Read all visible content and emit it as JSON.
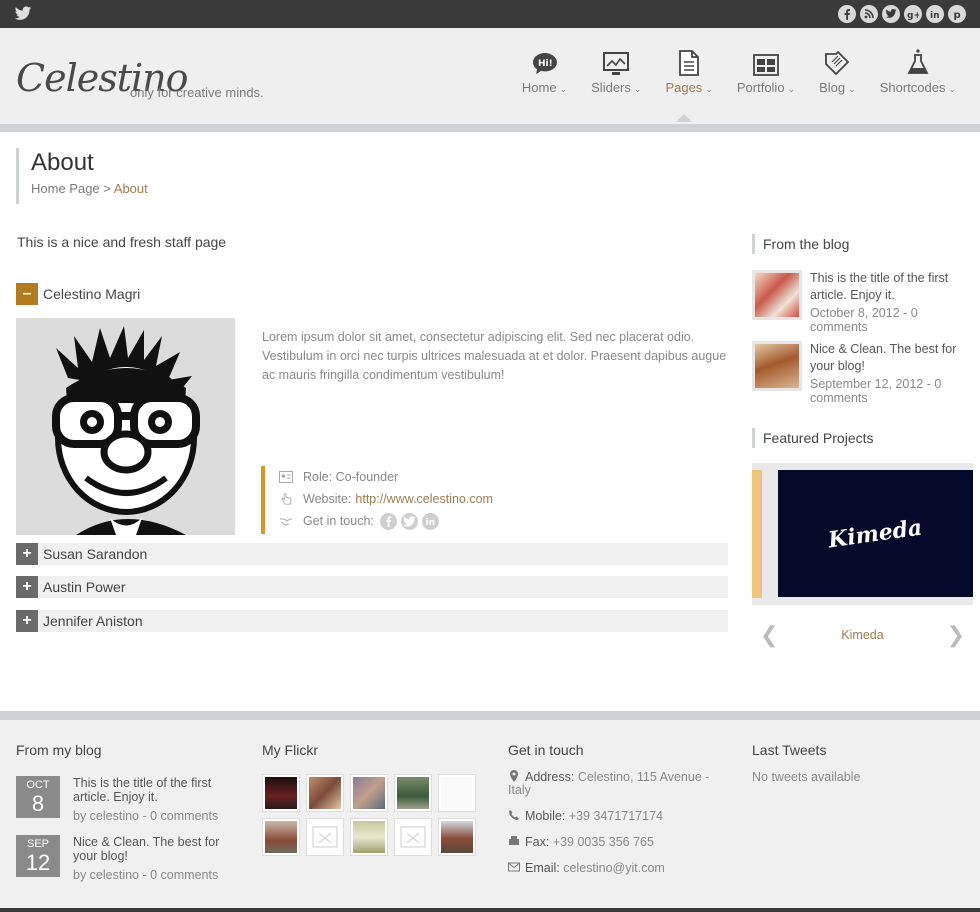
{
  "header": {
    "logo": "Celestino",
    "tagline": "only for creative minds.",
    "nav": [
      {
        "label": "Home",
        "icon": "speech-bubble-icon"
      },
      {
        "label": "Sliders",
        "icon": "chart-icon"
      },
      {
        "label": "Pages",
        "icon": "document-icon",
        "active": true
      },
      {
        "label": "Portfolio",
        "icon": "grid-icon"
      },
      {
        "label": "Blog",
        "icon": "tag-icon"
      },
      {
        "label": "Shortcodes",
        "icon": "flask-icon"
      }
    ],
    "home_icon_text": "Hi!"
  },
  "page": {
    "title": "About",
    "breadcrumb_home": "Home Page",
    "breadcrumb_sep": ">",
    "breadcrumb_current": "About",
    "intro": "This is a nice and fresh staff page"
  },
  "staff": {
    "open_name": "Celestino Magri",
    "bio": "Lorem ipsum dolor sit amet, consectetur adipiscing elit. Sed nec placerat odio. Vestibulum in orci nec turpis ultrices malesuada at et dolor. Praesent dapibus augue ac mauris fringilla condimentum vestibulum!",
    "role": "Role: Co-founder",
    "website_label": "Website:",
    "website_url": "http://www.celestino.com",
    "contact_label": "Get in touch:",
    "others": [
      "Susan Sarandon",
      "Austin Power",
      "Jennifer Aniston"
    ]
  },
  "sidebar": {
    "blog_heading": "From the blog",
    "posts": [
      {
        "title": "This is the title of the first article. Enjoy it.",
        "date": "October 8, 2012 - 0 comments"
      },
      {
        "title": "Nice & Clean. The best for your blog!",
        "date": "September 12, 2012 - 0 comments"
      }
    ],
    "featured_heading": "Featured Projects",
    "featured_image_text": "Kimeda",
    "featured_caption": "Kimeda"
  },
  "footer": {
    "blog_heading": "From my blog",
    "posts": [
      {
        "month": "OCT",
        "day": "8",
        "title": "This is the title of the first article. Enjoy it.",
        "by": "by celestino - 0 comments"
      },
      {
        "month": "SEP",
        "day": "12",
        "title": "Nice & Clean. The best for your blog!",
        "by": "by celestino - 0 comments"
      }
    ],
    "flickr_heading": "My Flickr",
    "contact_heading": "Get in touch",
    "address_label": "Address:",
    "address": "Celestino, 115 Avenue - Italy",
    "mobile_label": "Mobile:",
    "mobile": "+39 3471717174",
    "fax_label": "Fax:",
    "fax": "+39 0035 356 765",
    "email_label": "Email:",
    "email": "celestino@yit.com",
    "tweets_heading": "Last Tweets",
    "tweets_empty": "No tweets available"
  },
  "colors": {
    "accent": "#a07a50",
    "accordion_open": "#b37a1f",
    "meta_bar": "#d79722",
    "topbar": "#3a3a3a"
  }
}
